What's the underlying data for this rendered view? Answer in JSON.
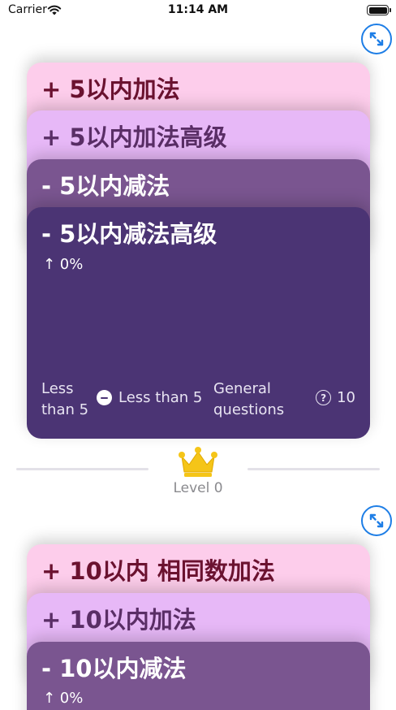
{
  "status_bar": {
    "carrier": "Carrier",
    "time": "11:14 AM"
  },
  "colors": {
    "accent_blue": "#1e7ee6",
    "card_pink": "#fdcdeb",
    "card_lavender": "#e7b8f7",
    "card_purple": "#7a5590",
    "card_dark_purple": "#4b3474",
    "title_dark_red": "#6b1230",
    "title_dark_purple": "#5a2e66",
    "crown_gold": "#f5c518"
  },
  "group1": {
    "expand_icon": "expand-arrows-icon",
    "cards": [
      {
        "title": "+ 5以内加法"
      },
      {
        "title": "+ 5以内加法高级"
      },
      {
        "title": "- 5以内减法"
      },
      {
        "title": "- 5以内减法高级",
        "progress": "↑ 0%",
        "footer": {
          "left_line1": "Less",
          "left_line2": "than 5",
          "mid_label": "Less than 5",
          "right_line1": "General",
          "right_line2": "questions",
          "count": "10"
        }
      }
    ]
  },
  "level": {
    "icon": "crown-icon",
    "label": "Level 0"
  },
  "group2": {
    "expand_icon": "expand-arrows-icon",
    "cards": [
      {
        "title": "+ 10以内 相同数加法"
      },
      {
        "title": "+ 10以内加法"
      },
      {
        "title": "- 10以内减法",
        "progress": "↑ 0%"
      }
    ]
  }
}
